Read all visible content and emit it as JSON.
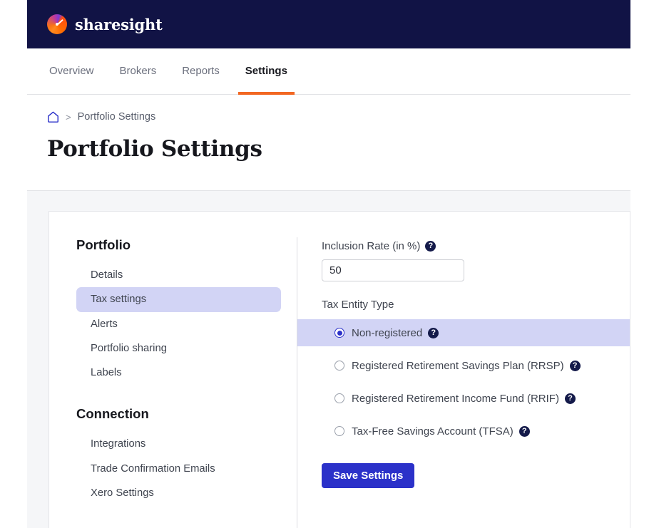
{
  "brand": {
    "name": "sharesight",
    "logo_icon": "sharesight-pie-logo-icon"
  },
  "nav": {
    "tabs": [
      {
        "label": "Overview",
        "active": false
      },
      {
        "label": "Brokers",
        "active": false
      },
      {
        "label": "Reports",
        "active": false
      },
      {
        "label": "Settings",
        "active": true
      }
    ]
  },
  "breadcrumb": {
    "home_icon": "home-icon",
    "separator": ">",
    "current": "Portfolio Settings"
  },
  "page": {
    "title": "Portfolio Settings"
  },
  "sidebar": {
    "groups": [
      {
        "title": "Portfolio",
        "items": [
          {
            "label": "Details",
            "active": false
          },
          {
            "label": "Tax settings",
            "active": true
          },
          {
            "label": "Alerts",
            "active": false
          },
          {
            "label": "Portfolio sharing",
            "active": false
          },
          {
            "label": "Labels",
            "active": false
          }
        ]
      },
      {
        "title": "Connection",
        "items": [
          {
            "label": "Integrations",
            "active": false
          },
          {
            "label": "Trade Confirmation Emails",
            "active": false
          },
          {
            "label": "Xero Settings",
            "active": false
          }
        ]
      }
    ]
  },
  "form": {
    "inclusion_rate": {
      "label": "Inclusion Rate (in %)",
      "help_icon": "help-circle-icon",
      "value": "50",
      "placeholder": ""
    },
    "tax_entity_type": {
      "label": "Tax Entity Type",
      "options": [
        {
          "label": "Non-registered",
          "selected": true,
          "help_icon": "help-circle-icon"
        },
        {
          "label": "Registered Retirement Savings Plan (RRSP)",
          "selected": false,
          "help_icon": "help-circle-icon"
        },
        {
          "label": "Registered Retirement Income Fund (RRIF)",
          "selected": false,
          "help_icon": "help-circle-icon"
        },
        {
          "label": "Tax-Free Savings Account (TFSA)",
          "selected": false,
          "help_icon": "help-circle-icon"
        }
      ]
    },
    "save_label": "Save Settings"
  },
  "colors": {
    "brand_navy": "#111345",
    "accent_orange": "#f26722",
    "primary_blue": "#2b31c9",
    "highlight_lavender": "#d2d4f5",
    "page_gray": "#f5f6f8"
  }
}
